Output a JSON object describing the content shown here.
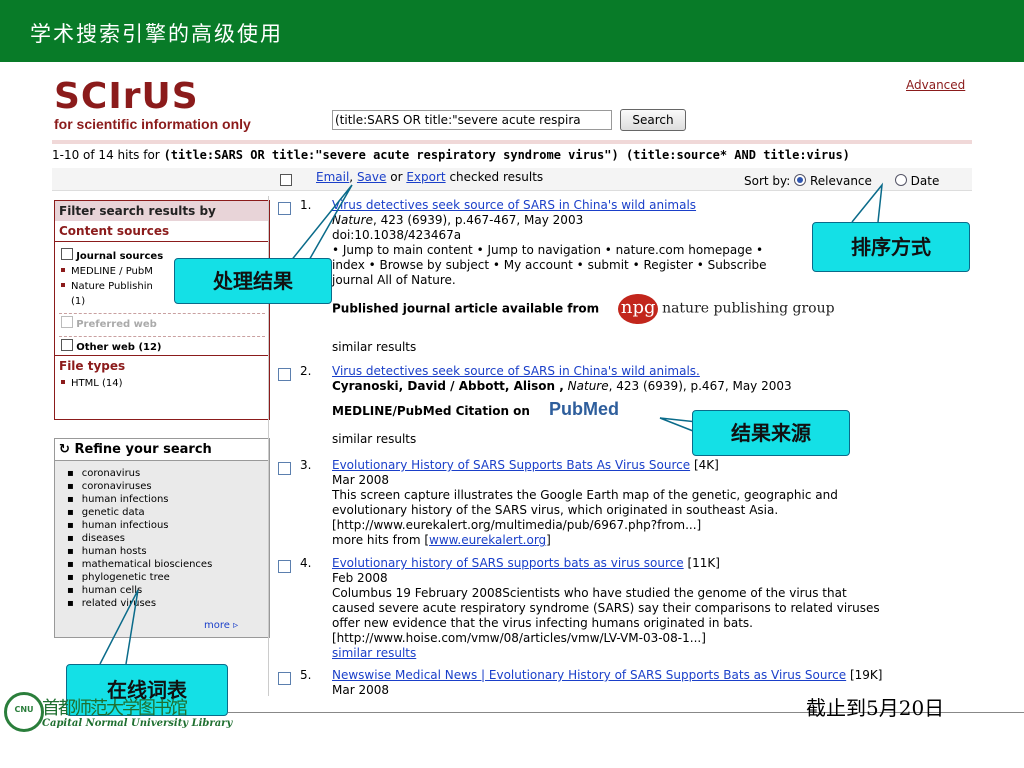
{
  "slide": {
    "title": "学术搜索引擎的高级使用",
    "date_note": "截止到5月20日",
    "library_name": "Capital Normal University Library",
    "library_glyphs": "首都师范大学图书馆",
    "badge_text": "CNU"
  },
  "colors": {
    "slide_header": "#087B28",
    "brand": "#8B1B1B",
    "link": "#1a3fc9",
    "callout": "#14e0e6"
  },
  "site": {
    "logo": "SCIrUS",
    "tagline": "for scientific information only",
    "advanced_link": "Advanced",
    "query": "(title:SARS OR title:\"severe acute respira",
    "search_button": "Search"
  },
  "hits": {
    "prefix": "1-10 of 14 hits for",
    "query_text": "(title:SARS OR title:\"severe acute respiratory syndrome virus\") (title:source* AND title:virus)"
  },
  "toolbar": {
    "email": "Email",
    "save": "Save",
    "export": "Export",
    "or_text": "or",
    "checked_results": "checked results",
    "sort_by": "Sort by:",
    "relevance": "Relevance",
    "date": "Date"
  },
  "filter": {
    "header": "Filter search results by",
    "content_sources": "Content sources",
    "journal_sources": "Journal sources",
    "journal_items": [
      "MEDLINE / PubM",
      "Nature Publishin",
      "(1)"
    ],
    "preferred_web": "Preferred web",
    "other_web": "Other web (12)",
    "file_types": "File types",
    "html": "HTML (14)"
  },
  "refine": {
    "header": "Refine your search",
    "terms": [
      "coronavirus",
      "coronaviruses",
      "human infections",
      "genetic data",
      "human infectious",
      "diseases",
      "human hosts",
      "mathematical biosciences",
      "phylogenetic tree",
      "human cells",
      "related viruses"
    ],
    "more": "more ▹"
  },
  "results": [
    {
      "num": "1.",
      "title": "Virus detectives seek source of SARS in China's wild animals",
      "line2_italic": "Nature",
      "line2": ", 423 (6939), p.467-467, May 2003",
      "line3": "doi:10.1038/423467a",
      "line4": "• Jump to main content • Jump to navigation • nature.com homepage •",
      "line5": "index • Browse by subject • My account • submit • Register • Subscribe",
      "line6": "journal All of Nature.",
      "available": "Published journal article available from",
      "publisher_logo": "npg",
      "publisher_name": "nature publishing group",
      "similar": "similar results"
    },
    {
      "num": "2.",
      "title": "Virus detectives seek source of SARS in China's wild animals.",
      "authors": "Cyranoski, David / Abbott, Alison ,",
      "journal_italic": "Nature",
      "line2": ", 423 (6939), p.467, May 2003",
      "citation": "MEDLINE/PubMed Citation on",
      "pubmed_logo": "PubMed",
      "similar": "similar results"
    },
    {
      "num": "3.",
      "title": "Evolutionary History of SARS Supports Bats As Virus Source",
      "size": "[4K]",
      "date": "Mar 2008",
      "desc1": "This screen capture illustrates the Google Earth map of the genetic, geographic and",
      "desc2": "evolutionary history of the SARS virus, which originated in southeast Asia.",
      "desc3": "[http://www.eurekalert.org/multimedia/pub/6967.php?from...]",
      "more_hits": "more hits from [",
      "more_site": "www.eurekalert.org",
      "more_end": "]"
    },
    {
      "num": "4.",
      "title": "Evolutionary history of SARS supports bats as virus source",
      "size": "[11K]",
      "date": "Feb 2008",
      "desc1": "Columbus 19 February 2008Scientists who have studied the genome of the virus that",
      "desc2": "caused severe acute respiratory syndrome (SARS) say their comparisons to related viruses",
      "desc3": "offer new evidence that the virus infecting humans originated in bats.",
      "desc4": "[http://www.hoise.com/vmw/08/articles/vmw/LV-VM-03-08-1...]",
      "similar": "similar results"
    },
    {
      "num": "5.",
      "title": "Newswise Medical News | Evolutionary History of SARS Supports Bats as Virus Source",
      "size": "[19K]",
      "date": "Mar 2008"
    }
  ],
  "callouts": {
    "process": "处理结果",
    "sort": "排序方式",
    "source": "结果来源",
    "thesaurus": "在线词表"
  }
}
